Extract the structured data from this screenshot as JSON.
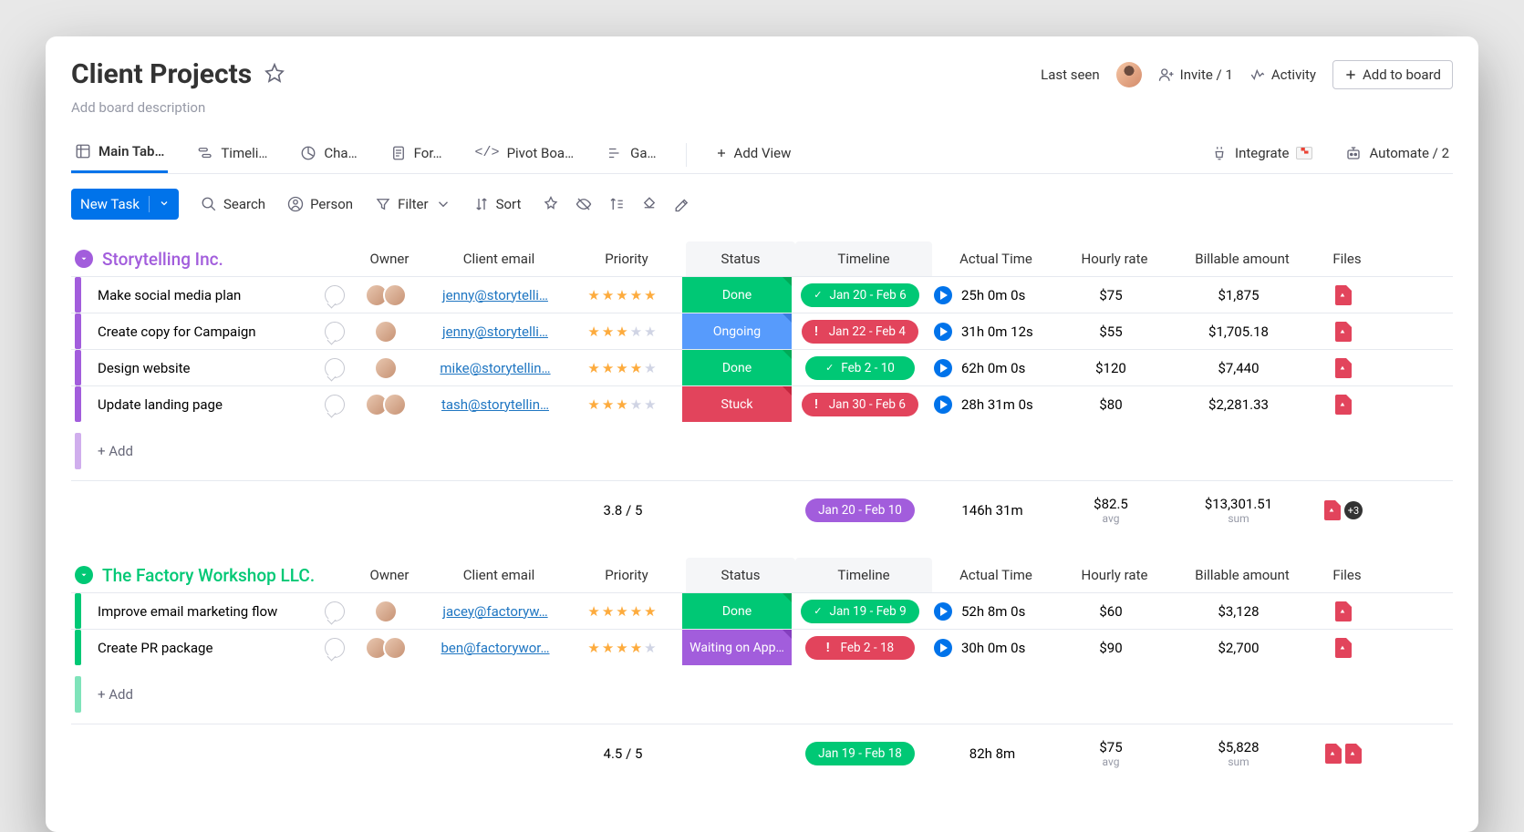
{
  "header": {
    "title": "Client Projects",
    "description_placeholder": "Add board description",
    "last_seen": "Last seen",
    "invite": "Invite / 1",
    "activity": "Activity",
    "add_to_board": "Add to board"
  },
  "views": {
    "tabs": [
      "Main Tab…",
      "Timeli…",
      "Cha…",
      "For…",
      "Pivot Boa…",
      "Ga…"
    ],
    "add_view": "Add View",
    "integrate": "Integrate",
    "automate": "Automate / 2"
  },
  "toolbar": {
    "new_task": "New Task",
    "search": "Search",
    "person": "Person",
    "filter": "Filter",
    "sort": "Sort"
  },
  "columns": [
    "Owner",
    "Client email",
    "Priority",
    "Status",
    "Timeline",
    "Actual Time",
    "Hourly rate",
    "Billable amount",
    "Files"
  ],
  "groups": [
    {
      "name": "Storytelling Inc.",
      "color": "#a25ddc",
      "rows": [
        {
          "task": "Make social media plan",
          "owners": 2,
          "email": "jenny@storytelli…",
          "stars": 5,
          "status": "Done",
          "status_color": "#00c875",
          "tl": "Jan 20 - Feb 6",
          "tl_color": "#00c875",
          "tl_icon": "check",
          "time": "25h 0m 0s",
          "rate": "$75",
          "bill": "$1,875"
        },
        {
          "task": "Create copy for Campaign",
          "owners": 1,
          "email": "jenny@storytelli…",
          "stars": 3,
          "status": "Ongoing",
          "status_color": "#579bfc",
          "tl": "Jan 22 - Feb 4",
          "tl_color": "#e2445c",
          "tl_icon": "bang",
          "time": "31h 0m 12s",
          "rate": "$55",
          "bill": "$1,705.18"
        },
        {
          "task": "Design website",
          "owners": 1,
          "email": "mike@storytellin…",
          "stars": 4,
          "status": "Done",
          "status_color": "#00c875",
          "tl": "Feb 2 - 10",
          "tl_color": "#00c875",
          "tl_icon": "check",
          "time": "62h 0m 0s",
          "rate": "$120",
          "bill": "$7,440"
        },
        {
          "task": "Update landing page",
          "owners": 2,
          "email": "tash@storytellin…",
          "stars": 3,
          "status": "Stuck",
          "status_color": "#e2445c",
          "tl": "Jan 30 - Feb 6",
          "tl_color": "#e2445c",
          "tl_icon": "bang",
          "time": "28h 31m 0s",
          "rate": "$80",
          "bill": "$2,281.33"
        }
      ],
      "add": "+ Add",
      "summary": {
        "priority": "3.8 / 5",
        "tl": "Jan 20 - Feb 10",
        "tl_color": "#a25ddc",
        "time": "146h 31m",
        "rate": "$82.5",
        "rate_sub": "avg",
        "bill": "$13,301.51",
        "bill_sub": "sum",
        "files_extra": "+3"
      }
    },
    {
      "name": "The Factory Workshop LLC.",
      "color": "#00c875",
      "rows": [
        {
          "task": "Improve email marketing flow",
          "owners": 1,
          "email": "jacey@factoryw…",
          "stars": 5,
          "status": "Done",
          "status_color": "#00c875",
          "tl": "Jan 19 - Feb 9",
          "tl_color": "#00c875",
          "tl_icon": "check",
          "time": "52h 8m 0s",
          "rate": "$60",
          "bill": "$3,128"
        },
        {
          "task": "Create PR package",
          "owners": 2,
          "email": "ben@factorywor…",
          "stars": 4,
          "status": "Waiting on App…",
          "status_color": "#a25ddc",
          "tl": "Feb 2 - 18",
          "tl_color": "#e2445c",
          "tl_icon": "bang",
          "time": "30h 0m 0s",
          "rate": "$90",
          "bill": "$2,700"
        }
      ],
      "add": "+ Add",
      "summary": {
        "priority": "4.5 / 5",
        "tl": "Jan 19 - Feb 18",
        "tl_color": "#00c875",
        "time": "82h 8m",
        "rate": "$75",
        "rate_sub": "avg",
        "bill": "$5,828",
        "bill_sub": "sum",
        "files_extra": ""
      }
    }
  ]
}
